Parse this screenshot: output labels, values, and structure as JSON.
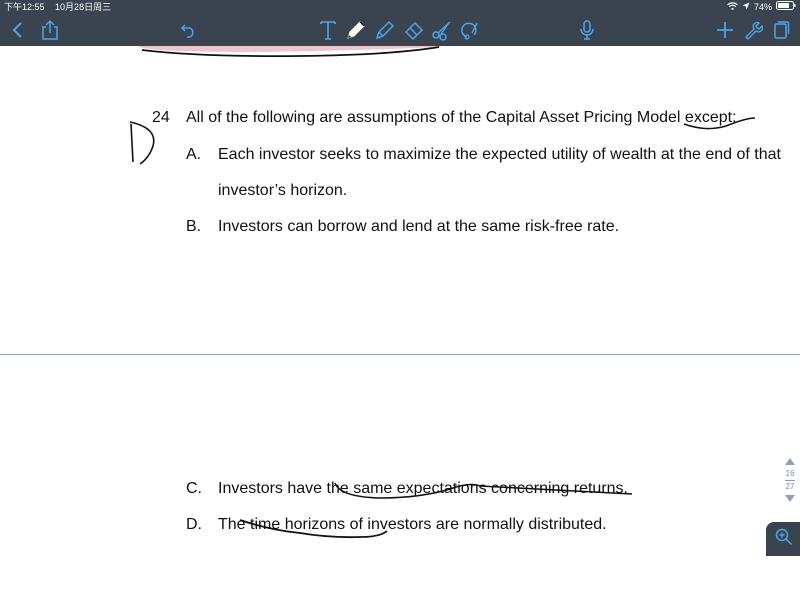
{
  "status_bar": {
    "time": "下午12:55",
    "date": "10月28日周三",
    "battery": "74%"
  },
  "toolbar": {
    "left_icons": [
      "back-chevron-icon",
      "share-icon",
      "undo-icon"
    ],
    "tool_icons": [
      "text-tool-icon",
      "pen-tool-icon",
      "highlighter-tool-icon",
      "eraser-tool-icon",
      "scissors-tool-icon",
      "lasso-tool-icon"
    ],
    "right_icons": [
      "microphone-icon",
      "add-icon",
      "wrench-icon",
      "pages-icon"
    ],
    "background_color": "#3a4350"
  },
  "question": {
    "number": "24",
    "stem": "All of the following are assumptions of the Capital Asset Pricing Model except:",
    "handwritten_answer": "D",
    "options": [
      {
        "letter": "A.",
        "lines": [
          "Each investor seeks to maximize the expected utility of wealth at the end of that",
          "investor’s horizon."
        ]
      },
      {
        "letter": "B.",
        "lines": [
          "Investors can borrow and lend at the same risk-free rate."
        ]
      },
      {
        "letter": "C.",
        "lines": [
          "Investors have the same expectations concerning returns."
        ]
      },
      {
        "letter": "D.",
        "lines": [
          "The time horizons of investors are normally distributed."
        ]
      }
    ]
  },
  "pager": {
    "current": "16",
    "total": "27"
  }
}
